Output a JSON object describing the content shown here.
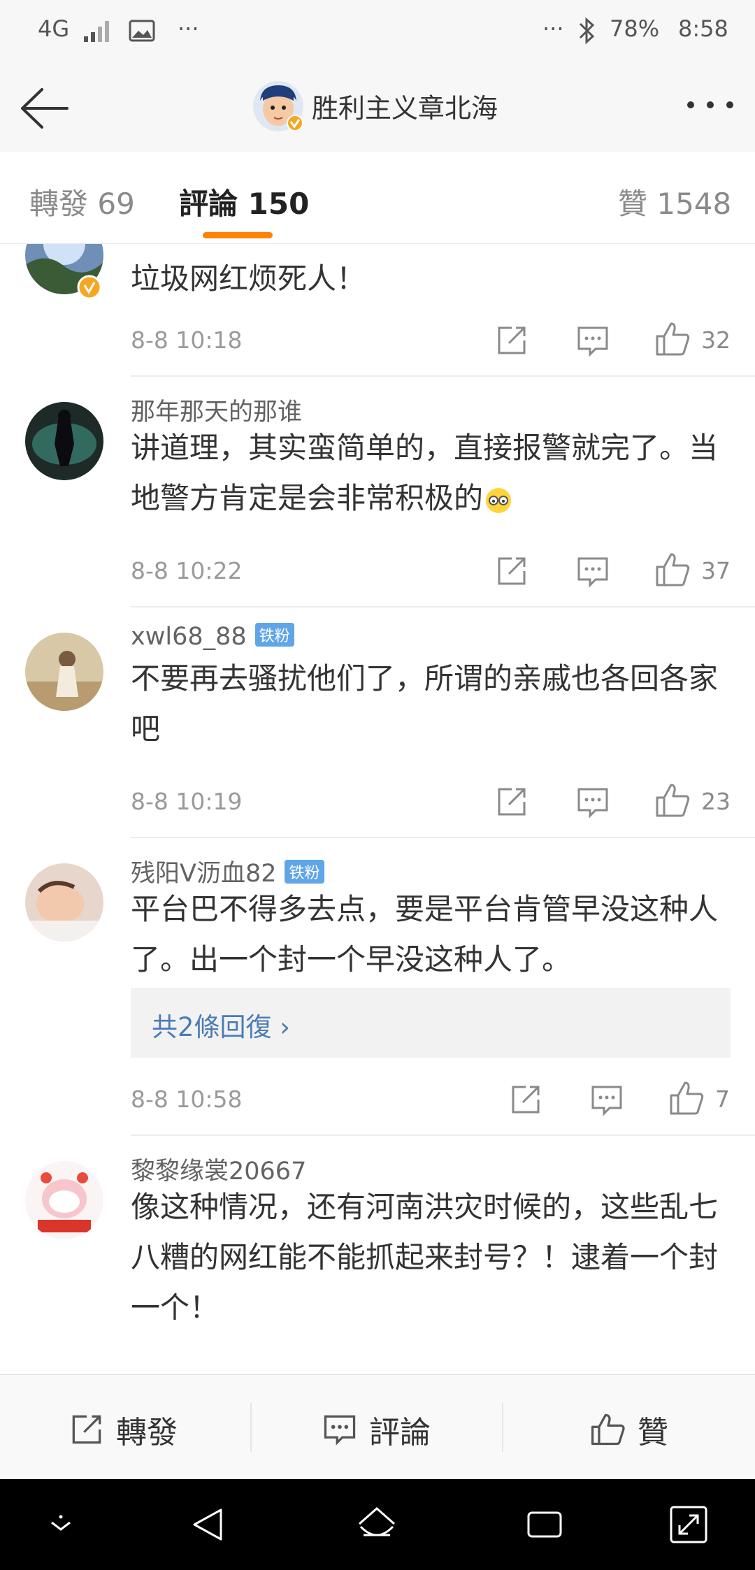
{
  "status_bar": {
    "network": "4G",
    "dots_left": "···",
    "dots_right": "···",
    "battery": "78%",
    "time": "8:58"
  },
  "header": {
    "title": "胜利主义章北海"
  },
  "tabs": {
    "forward": "轉發 69",
    "comments": "評論 150",
    "likes": "贊 1548"
  },
  "comments": [
    {
      "user": "",
      "text": "垃圾网红烦死人！",
      "time": "8-8 10:18",
      "likes": "32"
    },
    {
      "user": "那年那天的那谁",
      "text": "讲道理，其实蛮简单的，直接报警就完了。当地警方肯定是会非常积极的",
      "time": "8-8 10:22",
      "likes": "37"
    },
    {
      "user": "xwl68_88",
      "badge": "铁粉",
      "text": "不要再去骚扰他们了，所谓的亲戚也各回各家吧",
      "time": "8-8 10:19",
      "likes": "23"
    },
    {
      "user": "残阳V沥血82",
      "badge": "铁粉",
      "text": "平台巴不得多去点，要是平台肯管早没这种人了。出一个封一个早没这种人了。",
      "reply_link": "共2條回復 ›",
      "time": "8-8 10:58",
      "likes": "7"
    },
    {
      "user": "黎黎缘裳20667",
      "text": "像这种情况，还有河南洪灾时候的，这些乱七八糟的网红能不能抓起来封号？！逮着一个封一个！"
    }
  ],
  "bottom_bar": {
    "forward": "轉發",
    "comment": "評論",
    "like": "贊"
  },
  "colors": {
    "accent": "#ff8200",
    "link": "#4a7bb7",
    "badge": "#5fa5e8"
  }
}
